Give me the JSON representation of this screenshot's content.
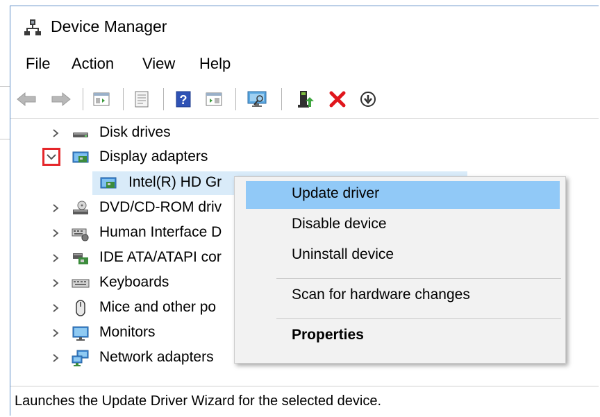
{
  "window": {
    "title": "Device Manager",
    "app_icon": "device-manager-icon"
  },
  "menubar": {
    "items": [
      {
        "label": "File"
      },
      {
        "label": "Action"
      },
      {
        "label": "View"
      },
      {
        "label": "Help"
      }
    ]
  },
  "toolbar": {
    "buttons": [
      {
        "icon": "back-arrow-icon"
      },
      {
        "icon": "forward-arrow-icon"
      },
      {
        "icon": "show-hide-console-tree-icon"
      },
      {
        "icon": "properties-sheet-icon"
      },
      {
        "icon": "help-icon"
      },
      {
        "icon": "show-action-pane-icon"
      },
      {
        "icon": "scan-hardware-monitor-icon"
      },
      {
        "icon": "update-driver-icon"
      },
      {
        "icon": "uninstall-x-icon"
      },
      {
        "icon": "disable-device-down-arrow-icon"
      }
    ]
  },
  "tree": {
    "items": [
      {
        "label": "Disk drives",
        "icon": "disk-drive-icon",
        "state": "collapsed"
      },
      {
        "label": "Display adapters",
        "icon": "display-adapter-icon",
        "state": "expanded"
      },
      {
        "label": "Intel(R) HD Gr",
        "icon": "display-adapter-icon",
        "state": "child-selected"
      },
      {
        "label": "DVD/CD-ROM driv",
        "icon": "dvd-drive-icon",
        "state": "collapsed"
      },
      {
        "label": "Human Interface D",
        "icon": "hid-keyboard-icon",
        "state": "collapsed"
      },
      {
        "label": "IDE ATA/ATAPI cor",
        "icon": "ide-controller-icon",
        "state": "collapsed"
      },
      {
        "label": "Keyboards",
        "icon": "keyboard-icon",
        "state": "collapsed"
      },
      {
        "label": "Mice and other po",
        "icon": "mouse-icon",
        "state": "collapsed"
      },
      {
        "label": "Monitors",
        "icon": "monitor-icon",
        "state": "collapsed"
      },
      {
        "label": "Network adapters",
        "icon": "network-adapter-icon",
        "state": "collapsed"
      }
    ]
  },
  "context_menu": {
    "items": [
      {
        "label": "Update driver",
        "highlighted": true
      },
      {
        "label": "Disable device"
      },
      {
        "label": "Uninstall device"
      },
      {
        "label": "Scan for hardware changes"
      },
      {
        "label": "Properties",
        "bold": true
      }
    ]
  },
  "statusbar": {
    "text": "Launches the Update Driver Wizard for the selected device."
  },
  "colors": {
    "window_border": "#5f8fc7",
    "selection": "#d9ebf9",
    "menu_highlight": "#91c9f7",
    "annotation_red": "#e5262a",
    "delete_red": "#e0161c"
  }
}
